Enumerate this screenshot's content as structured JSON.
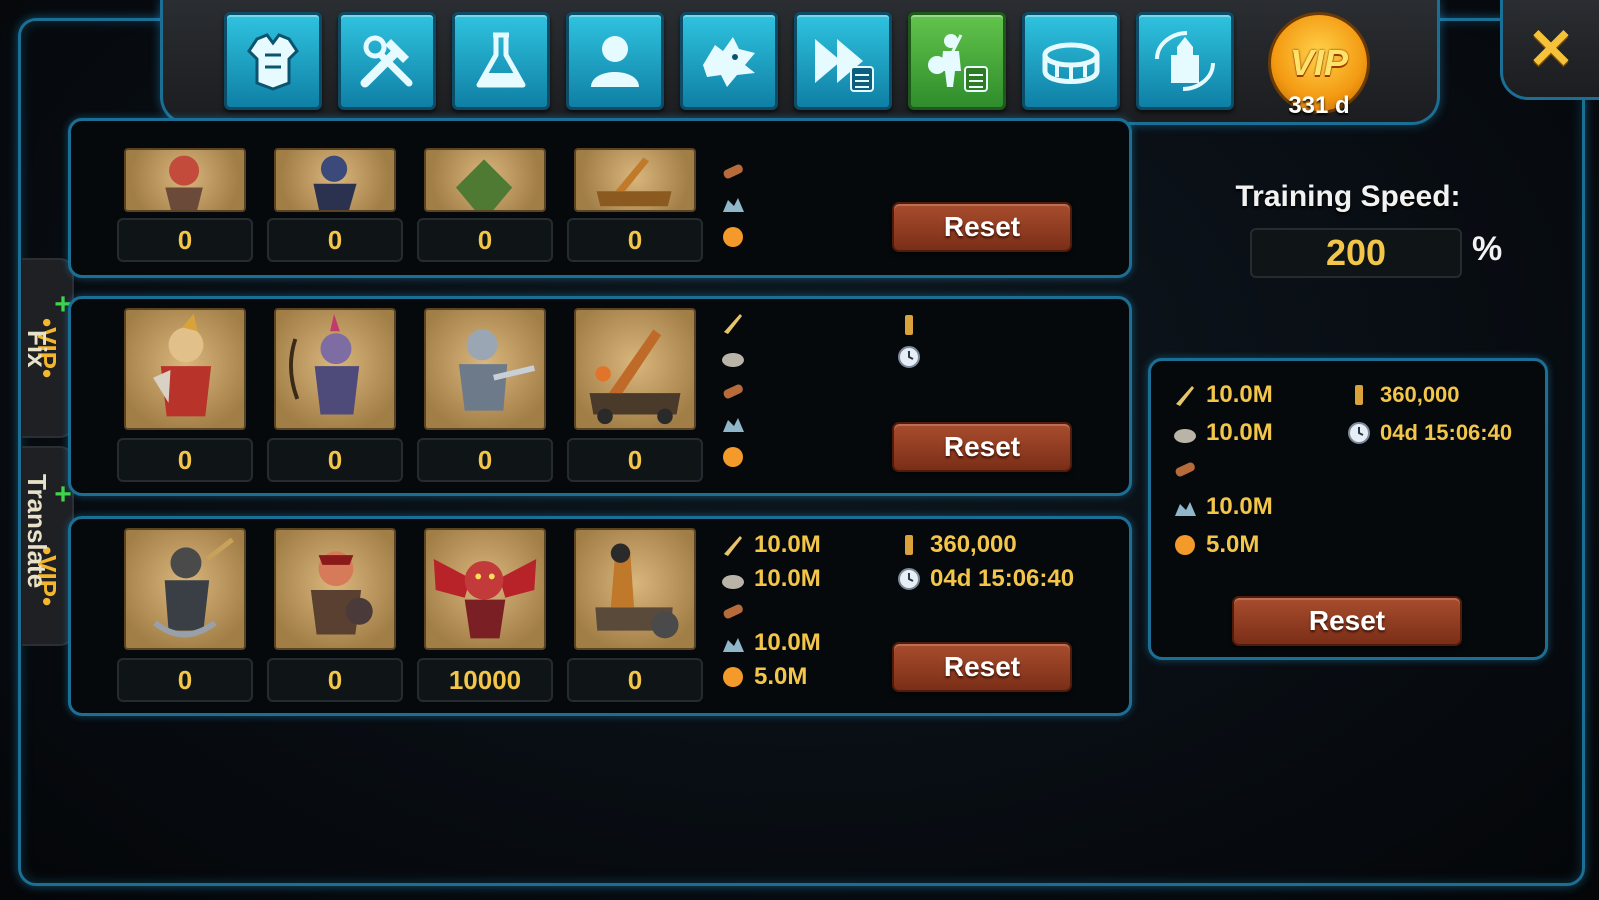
{
  "header": {
    "tabs": [
      {
        "icon": "armor-icon"
      },
      {
        "icon": "tools-icon"
      },
      {
        "icon": "flask-icon"
      },
      {
        "icon": "person-icon"
      },
      {
        "icon": "dragon-head-icon"
      },
      {
        "icon": "fast-forward-calculator-icon"
      },
      {
        "icon": "troop-calculator-icon",
        "active": true
      },
      {
        "icon": "arena-icon"
      },
      {
        "icon": "castle-refresh-icon"
      }
    ],
    "vip_label": "VIP",
    "vip_days": "331 d"
  },
  "side_tabs": {
    "fix": {
      "vip": "•VIP•",
      "sub": "Fix"
    },
    "translate": {
      "vip": "•VIP•",
      "sub": "Translate"
    }
  },
  "rows": [
    {
      "counts": [
        "0",
        "0",
        "0",
        "0"
      ],
      "resources": {
        "food": "",
        "stone": "",
        "wood": "",
        "ore": "",
        "gold": ""
      },
      "extra": {
        "power": "",
        "time": ""
      },
      "reset_label": "Reset"
    },
    {
      "counts": [
        "0",
        "0",
        "0",
        "0"
      ],
      "resources": {
        "food": "",
        "stone": "",
        "wood": "",
        "ore": "",
        "gold": ""
      },
      "extra": {
        "power": "",
        "time": ""
      },
      "reset_label": "Reset"
    },
    {
      "counts": [
        "0",
        "0",
        "10000",
        "0"
      ],
      "resources": {
        "food": "10.0M",
        "stone": "10.0M",
        "wood": "",
        "ore": "10.0M",
        "gold": "5.0M"
      },
      "extra": {
        "power": "360,000",
        "time": "04d 15:06:40"
      },
      "reset_label": "Reset"
    }
  ],
  "training": {
    "label": "Training Speed:",
    "value": "200",
    "unit": "%"
  },
  "summary": {
    "food": "10.0M",
    "stone": "10.0M",
    "wood": "",
    "ore": "10.0M",
    "gold": "5.0M",
    "power": "360,000",
    "time": "04d 15:06:40",
    "reset_label": "Reset"
  },
  "colors": {
    "accent": "#1b6f95",
    "gold_text": "#f3c64a",
    "reset_button": "#8d3b20",
    "tab": "#1fa3c8",
    "active_tab": "#4ba93a"
  }
}
